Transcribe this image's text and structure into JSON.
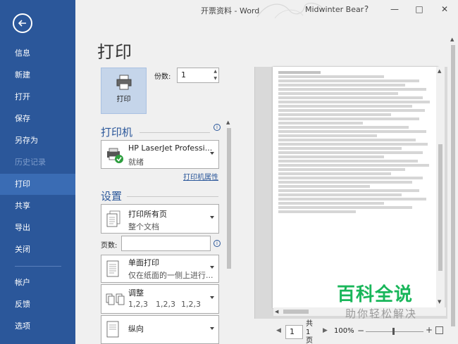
{
  "window": {
    "title": "开票资料 - Word",
    "user": "Midwinter Bear",
    "help": "?",
    "minimize": "—",
    "restore": "□",
    "close": "✕"
  },
  "nav": {
    "items": [
      {
        "label": "信息"
      },
      {
        "label": "新建"
      },
      {
        "label": "打开"
      },
      {
        "label": "保存"
      },
      {
        "label": "另存为"
      },
      {
        "label": "历史记录"
      },
      {
        "label": "打印"
      },
      {
        "label": "共享"
      },
      {
        "label": "导出"
      },
      {
        "label": "关闭"
      },
      {
        "label": "帐户"
      },
      {
        "label": "反馈"
      },
      {
        "label": "选项"
      }
    ]
  },
  "print": {
    "title": "打印",
    "print_button": "打印",
    "copies_label": "份数:",
    "copies_value": "1"
  },
  "printer": {
    "heading": "打印机",
    "name": "HP LaserJet Professi...",
    "status": "就绪",
    "properties_link": "打印机属性"
  },
  "settings": {
    "heading": "设置",
    "scope": {
      "main": "打印所有页",
      "sub": "整个文档"
    },
    "pages_label": "页数:",
    "duplex": {
      "main": "单面打印",
      "sub": "仅在纸面的一侧上进行..."
    },
    "collate": {
      "main": "调整",
      "sub1": "1,2,3",
      "sub2": "1,2,3",
      "sub3": "1,2,3"
    },
    "orientation": {
      "main": "纵向"
    }
  },
  "footer": {
    "page_num": "1",
    "page_total_1": "共",
    "page_total_2": "1",
    "page_total_3": "页",
    "zoom": "100%",
    "zoom_minus": "−",
    "zoom_plus": "+"
  },
  "watermark": {
    "main": "百科全说",
    "sub": "助你轻松解决"
  }
}
